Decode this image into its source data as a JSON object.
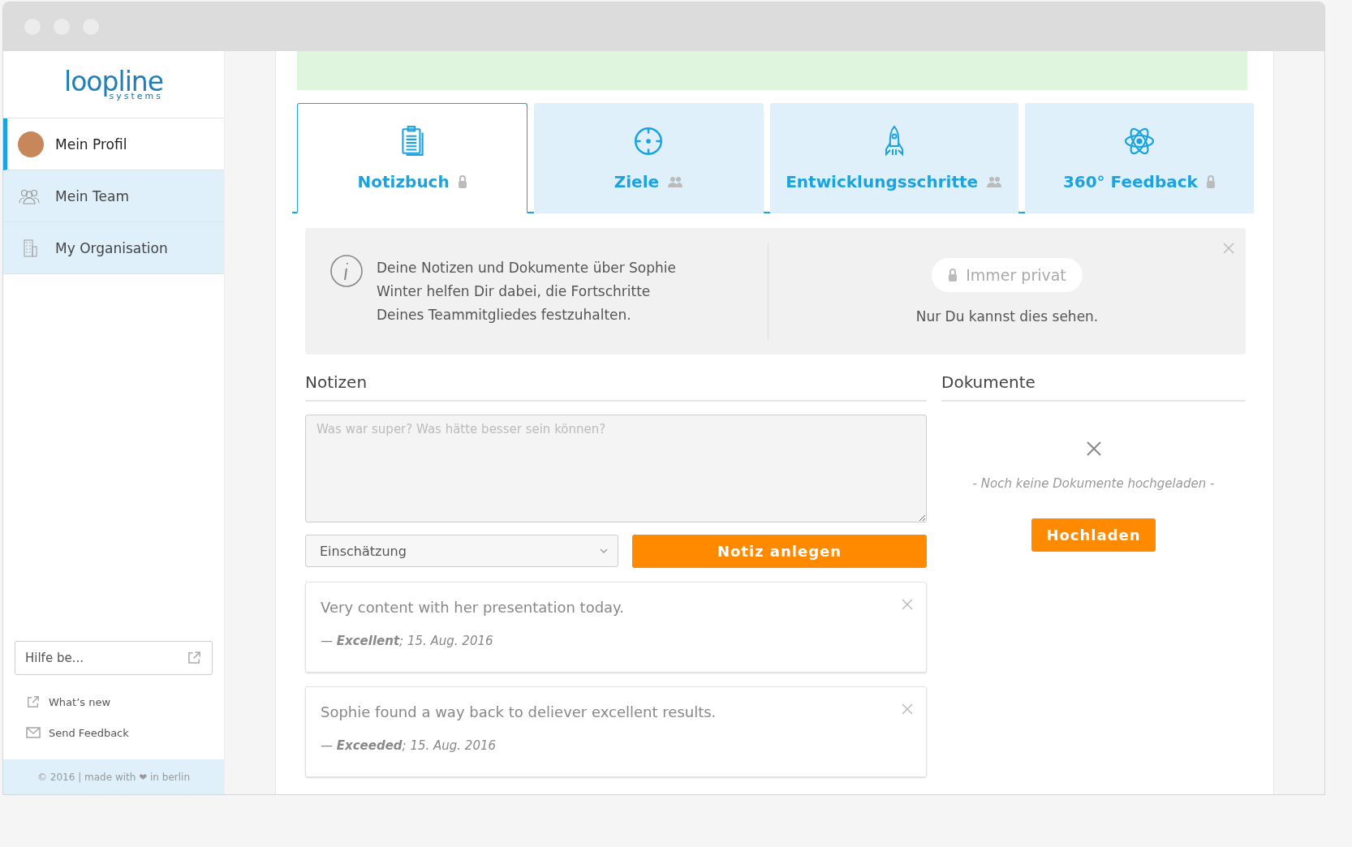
{
  "logo": {
    "name": "loopline",
    "tagline": "systems"
  },
  "sidebar": {
    "items": [
      {
        "label": "Mein Profil",
        "kind": "avatar",
        "selected": true
      },
      {
        "label": "Mein Team",
        "kind": "team",
        "selected": false
      },
      {
        "label": "My Organisation",
        "kind": "building",
        "selected": false
      }
    ],
    "help_field": {
      "placeholder": "Hilfe be..."
    },
    "links": [
      {
        "label": "What’s new",
        "kind": "external"
      },
      {
        "label": "Send Feedback",
        "kind": "mail"
      }
    ],
    "footer": "© 2016 | made with ❤ in berlin"
  },
  "tabs": [
    {
      "label": "Notizbuch",
      "selected": true
    },
    {
      "label": "Ziele",
      "selected": false
    },
    {
      "label": "Entwicklungsschritte",
      "selected": false
    },
    {
      "label": "360° Feedback",
      "selected": false
    }
  ],
  "info": {
    "text": "Deine Notizen und Dokumente über Sophie Winter helfen Dir dabei, die Fortschritte Deines Teammitgliedes festzuhalten.",
    "badge": "Immer privat",
    "caption": "Nur Du kannst dies sehen."
  },
  "notes": {
    "heading": "Notizen",
    "placeholder": "Was war super? Was hätte besser sein können?",
    "select": "Einschätzung",
    "button": "Notiz anlegen",
    "items": [
      {
        "text": "Very content with her presentation today.",
        "meta": "— **Excellent**; 15. Aug. 2016"
      },
      {
        "text": "Sophie found a way back to deliever excellent results.",
        "meta": "— **Exceeded**; 15. Aug. 2016"
      }
    ]
  },
  "documents": {
    "heading": "Dokumente",
    "empty": "- Noch keine Dokumente hochgeladen -",
    "button": "Hochladen"
  }
}
